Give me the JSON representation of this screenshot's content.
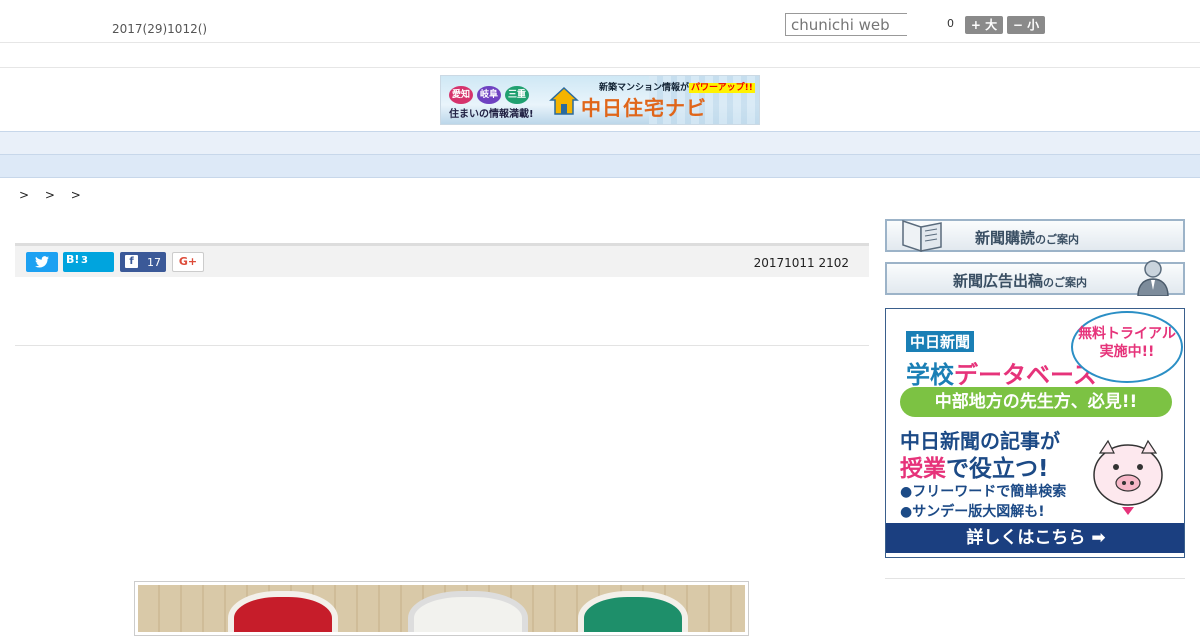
{
  "header": {
    "date": "2017(29)1012()",
    "search_placeholder": "chunichi web",
    "counter": "0",
    "font_larger": "+ 大",
    "font_smaller": "− 小"
  },
  "banner": {
    "prefectures": [
      "愛知",
      "岐阜",
      "三重"
    ],
    "tagline": "住まいの情報満載!",
    "name": "中日住宅ナビ",
    "pitch_prefix": "新築マンション情報が",
    "pitch_highlight": "パワーアップ!!"
  },
  "nav": {
    "items": [
      "",
      "",
      "",
      "",
      "",
      "",
      "",
      "",
      ""
    ]
  },
  "breadcrumb": "> > >",
  "share": {
    "twitter_icon": "bird",
    "hatena_label": "B!",
    "hatena_count": "3",
    "facebook_label": "f",
    "facebook_count": "17",
    "googleplus_label": "G+"
  },
  "article": {
    "timestamp": "20171011 2102"
  },
  "sidebar": {
    "subscribe_main": "新聞購読",
    "subscribe_sub": "のご案内",
    "ad_main": "新聞広告出稿",
    "ad_sub": "のご案内",
    "promo": {
      "brand": "中日新聞",
      "product_a": "学校",
      "product_b": "データベース",
      "bubble": "無料トライアル実施中!!",
      "ribbon": "中部地方の先生方、必見!!",
      "headline1": "中日新聞の記事が",
      "headline2_a": "授業",
      "headline2_b": "で役立つ!",
      "bullet1": "●フリーワードで簡単検索",
      "bullet2": "●サンデー版大図解も!",
      "cta": "詳しくはこちら ➡"
    }
  },
  "colors": {
    "nav_bg": "#e9f0f9",
    "twitter": "#1da1f2",
    "hatena": "#00a4de",
    "facebook": "#3b5998",
    "promo_cta": "#1b3f80"
  }
}
